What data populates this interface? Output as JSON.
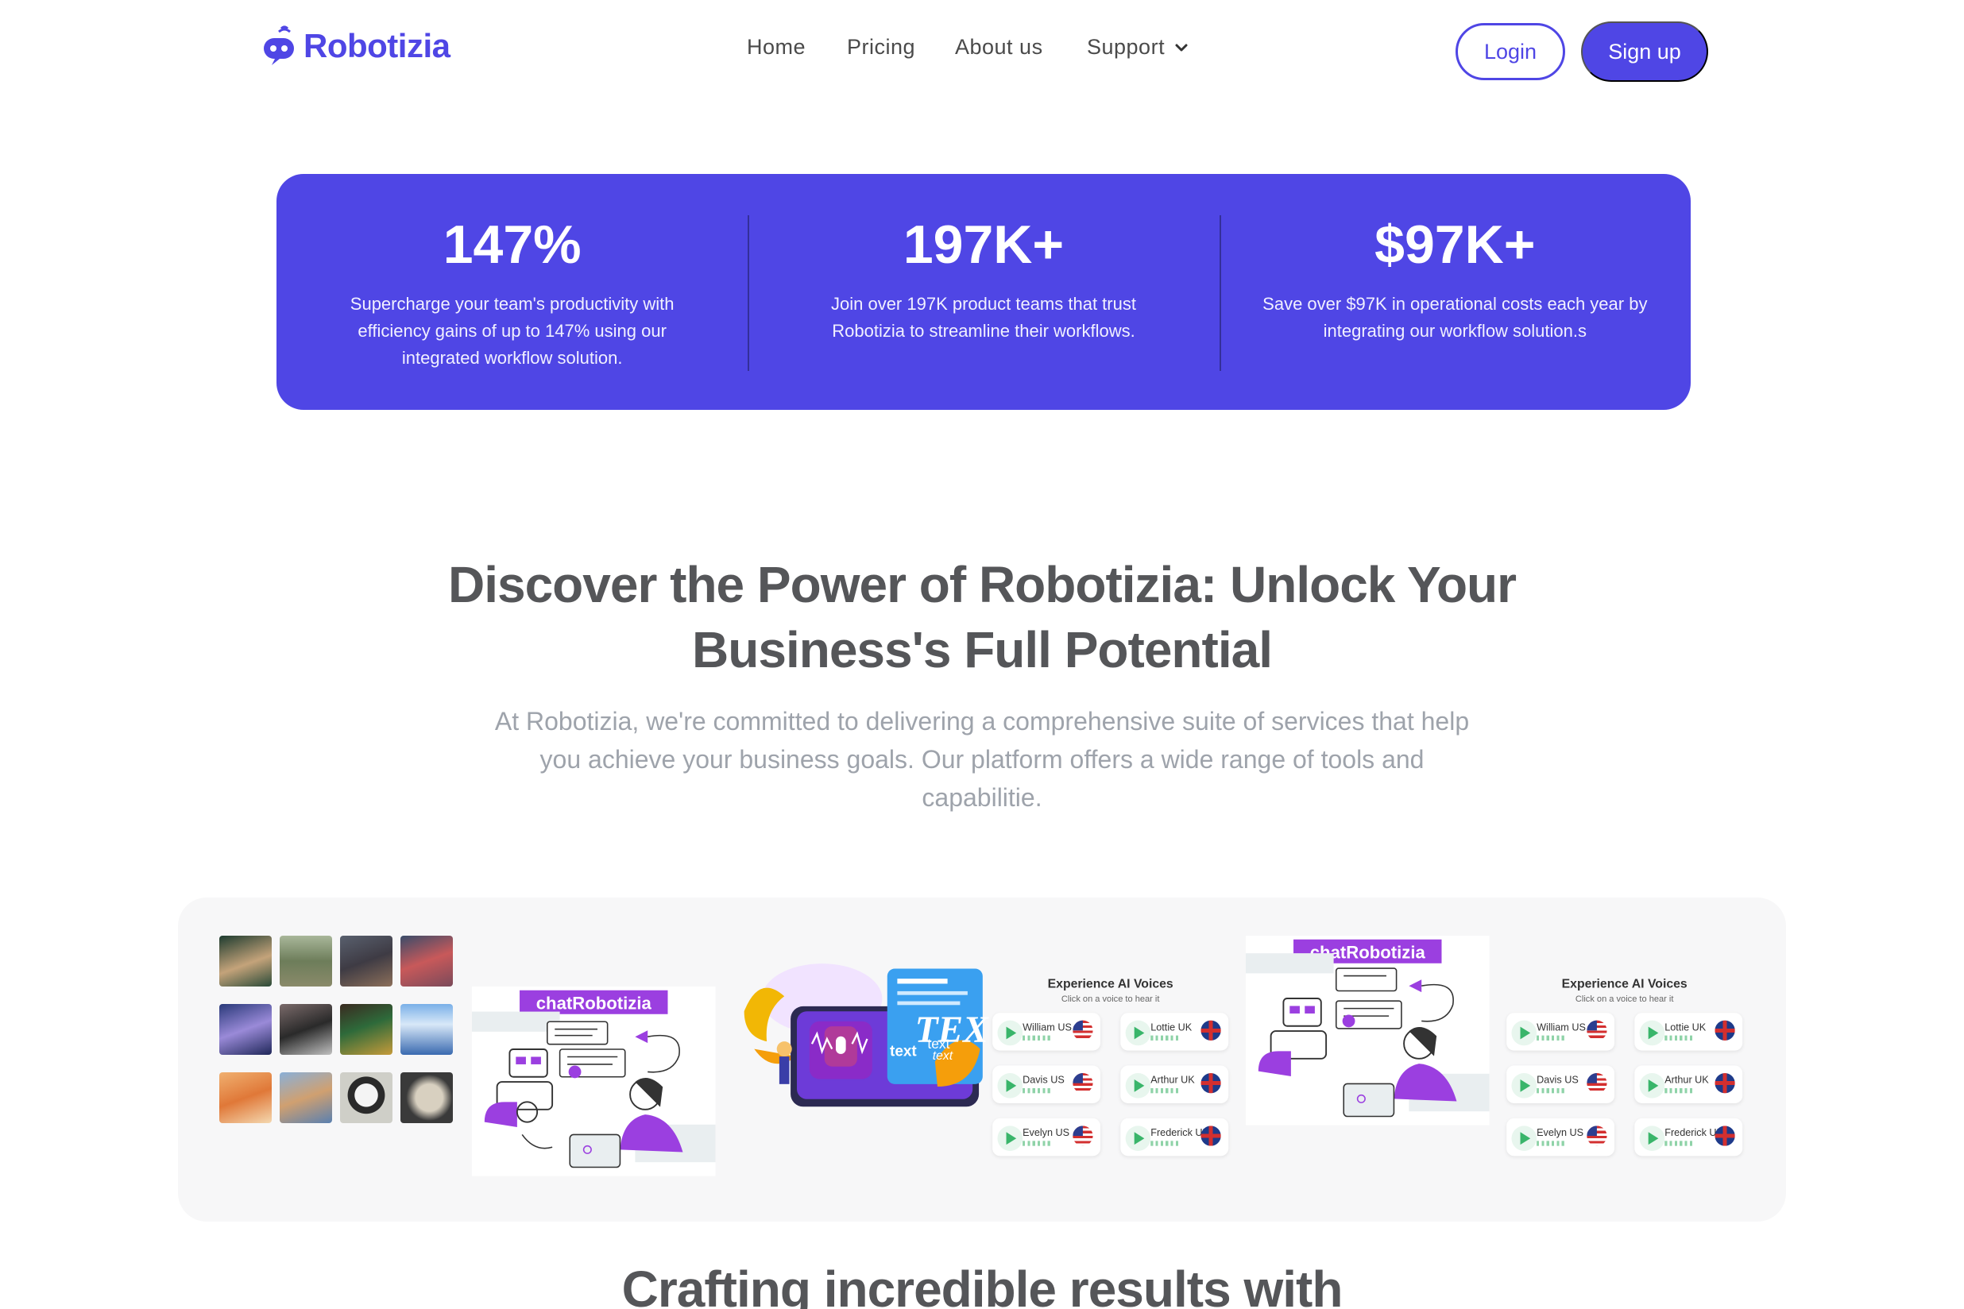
{
  "brand": {
    "name": "Robotizia",
    "color": "#4f46e5"
  },
  "nav": {
    "links": [
      "Home",
      "Pricing",
      "About us",
      "Support"
    ],
    "login": "Login",
    "signup": "Sign up"
  },
  "stats": [
    {
      "value": "147%",
      "desc": "Supercharge your team's productivity with efficiency gains of up to 147% using our integrated workflow solution."
    },
    {
      "value": "197K+",
      "desc": "Join over 197K product teams that trust Robotizia to streamline their workflows."
    },
    {
      "value": "$97K+",
      "desc": "Save over $97K in operational costs each year by integrating our workflow solution.s"
    }
  ],
  "hero": {
    "heading": "Discover the Power of Robotizia: Unlock Your Business's Full Potential",
    "lead": "At Robotizia, we're committed to delivering a comprehensive suite of services that help you achieve your business goals. Our platform offers a wide range of tools and capabilitie."
  },
  "gallery": {
    "chat_label": "chatRobotizia",
    "tts_labels": [
      "TEXT",
      "text",
      "text",
      "text"
    ],
    "voices_title": "Experience AI Voices",
    "voices_subtitle": "Click on a voice to hear it",
    "voices": [
      "William US",
      "Lottie UK",
      "Davis US",
      "Arthur UK",
      "Evelyn US",
      "Frederick UK"
    ]
  },
  "next_section": {
    "heading": "Crafting incredible results with"
  }
}
